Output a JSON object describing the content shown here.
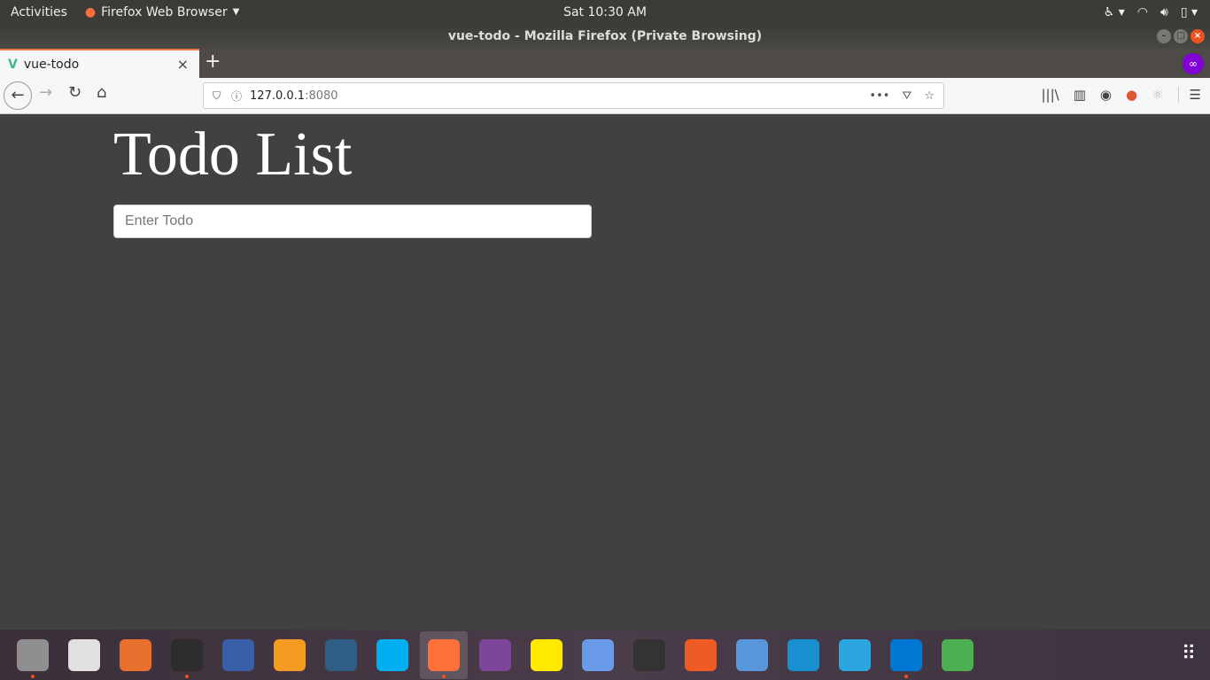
{
  "topbar": {
    "activities": "Activities",
    "app": "Firefox Web Browser",
    "clock": "Sat 10:30 AM"
  },
  "window": {
    "title": "vue-todo - Mozilla Firefox (Private Browsing)"
  },
  "tab": {
    "title": "vue-todo",
    "new_tab": "+"
  },
  "urlbar": {
    "host": "127.0.0.1",
    "port": ":8080"
  },
  "page": {
    "heading": "Todo List",
    "input_placeholder": "Enter Todo",
    "input_value": ""
  },
  "dock": {
    "apps": [
      {
        "name": "files",
        "color": "#8f8f8f",
        "running": true
      },
      {
        "name": "rhythmbox",
        "color": "#e0e0e0",
        "running": false
      },
      {
        "name": "software-center",
        "color": "#e86f2d",
        "running": false
      },
      {
        "name": "terminal",
        "color": "#2c2c2c",
        "running": true
      },
      {
        "name": "network-tool",
        "color": "#3a5fa8",
        "running": false
      },
      {
        "name": "sublime-text",
        "color": "#f49b22",
        "running": false
      },
      {
        "name": "mysql-workbench",
        "color": "#2f5e86",
        "running": false
      },
      {
        "name": "skype",
        "color": "#00aff0",
        "running": false
      },
      {
        "name": "firefox",
        "color": "#ff7139",
        "running": true,
        "active": true
      },
      {
        "name": "tor-browser",
        "color": "#7d4698",
        "running": false
      },
      {
        "name": "notes",
        "color": "#ffea00",
        "running": false
      },
      {
        "name": "chromium",
        "color": "#6a9be8",
        "running": false
      },
      {
        "name": "system-monitor",
        "color": "#333333",
        "running": false
      },
      {
        "name": "postman",
        "color": "#ef5b25",
        "running": false
      },
      {
        "name": "qbittorrent",
        "color": "#5796d9",
        "running": false
      },
      {
        "name": "app-blue",
        "color": "#1a8fd0",
        "running": false
      },
      {
        "name": "telegram",
        "color": "#2ca5e0",
        "running": false
      },
      {
        "name": "vscode",
        "color": "#0078d4",
        "running": true
      },
      {
        "name": "rocket-app",
        "color": "#4caf50",
        "running": false
      }
    ]
  },
  "colors": {
    "accent": "#e95420",
    "page_bg": "#414141",
    "private": "#8000d7"
  }
}
